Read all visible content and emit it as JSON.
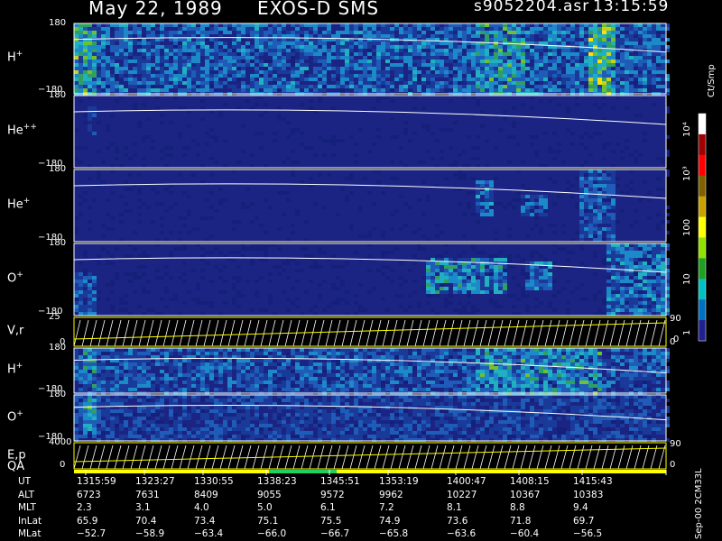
{
  "header": {
    "date": "May 22, 1989",
    "instrument": "EXOS-D SMS",
    "file": "s9052204.asr",
    "time": "13:15:59"
  },
  "colorbar": {
    "unit": "Ct/Smp",
    "labels": [
      "10⁴",
      "10³",
      "100",
      "10",
      "1",
      "0"
    ],
    "colors": [
      "#ffffff",
      "#a00000",
      "#ff0000",
      "#806000",
      "#c8a000",
      "#ffff00",
      "#90e000",
      "#20a020",
      "#00c0c0",
      "#0070c0",
      "#202090"
    ]
  },
  "panels": [
    {
      "label": "H",
      "sup": "+",
      "top": "180",
      "bottom": "−180"
    },
    {
      "label": "He",
      "sup": "++",
      "top": "180",
      "bottom": "−180"
    },
    {
      "label": "He",
      "sup": "+",
      "top": "180",
      "bottom": "−180"
    },
    {
      "label": "O",
      "sup": "+",
      "top": "180",
      "bottom": "−180"
    },
    {
      "label": "V,r",
      "sup": "",
      "top": "25",
      "bottom": "0",
      "right": "90",
      "right2": "0"
    },
    {
      "label": "H",
      "sup": "+",
      "top": "180",
      "bottom": "−180"
    },
    {
      "label": "O",
      "sup": "+",
      "top": "180",
      "bottom": "−180"
    },
    {
      "label": "E,p",
      "sup": "",
      "top": "4000",
      "bottom": "0",
      "right": "90",
      "right2": "0"
    }
  ],
  "qa_label": "QA",
  "side_note": "Sep-00 2CM33L",
  "table": {
    "rows": [
      {
        "name": "UT",
        "values": [
          "1315:59",
          "1323:27",
          "1330:55",
          "1338:23",
          "1345:51",
          "1353:19",
          "1400:47",
          "1408:15",
          "1415:43"
        ]
      },
      {
        "name": "ALT",
        "values": [
          "6723",
          "7631",
          "8409",
          "9055",
          "9572",
          "9962",
          "10227",
          "10367",
          "10383"
        ]
      },
      {
        "name": "MLT",
        "values": [
          "2.3",
          "3.1",
          "4.0",
          "5.0",
          "6.1",
          "7.2",
          "8.1",
          "8.8",
          "9.4"
        ]
      },
      {
        "name": "InLat",
        "values": [
          "65.9",
          "70.4",
          "73.4",
          "75.1",
          "75.5",
          "74.9",
          "73.6",
          "71.8",
          "69.7"
        ]
      },
      {
        "name": "MLat",
        "values": [
          "−52.7",
          "−58.9",
          "−63.4",
          "−66.0",
          "−66.7",
          "−65.8",
          "−63.6",
          "−60.4",
          "−56.5"
        ]
      }
    ]
  },
  "chart_data": {
    "type": "heatmap",
    "title": "May 22, 1989   EXOS-D SMS",
    "x": [
      "1315:59",
      "1323:27",
      "1330:55",
      "1338:23",
      "1345:51",
      "1353:19",
      "1400:47",
      "1408:15",
      "1415:43"
    ],
    "series": [
      {
        "name": "H+",
        "ylim": [
          -180,
          180
        ]
      },
      {
        "name": "He++",
        "ylim": [
          -180,
          180
        ]
      },
      {
        "name": "He+",
        "ylim": [
          -180,
          180
        ]
      },
      {
        "name": "O+",
        "ylim": [
          -180,
          180
        ]
      },
      {
        "name": "V,r",
        "ylim": [
          0,
          25
        ]
      },
      {
        "name": "H+",
        "ylim": [
          -180,
          180
        ]
      },
      {
        "name": "O+",
        "ylim": [
          -180,
          180
        ]
      },
      {
        "name": "E,p",
        "ylim": [
          0,
          4000
        ]
      }
    ],
    "colorscale": [
      "1",
      "10",
      "100",
      "10³",
      "10⁴"
    ]
  }
}
